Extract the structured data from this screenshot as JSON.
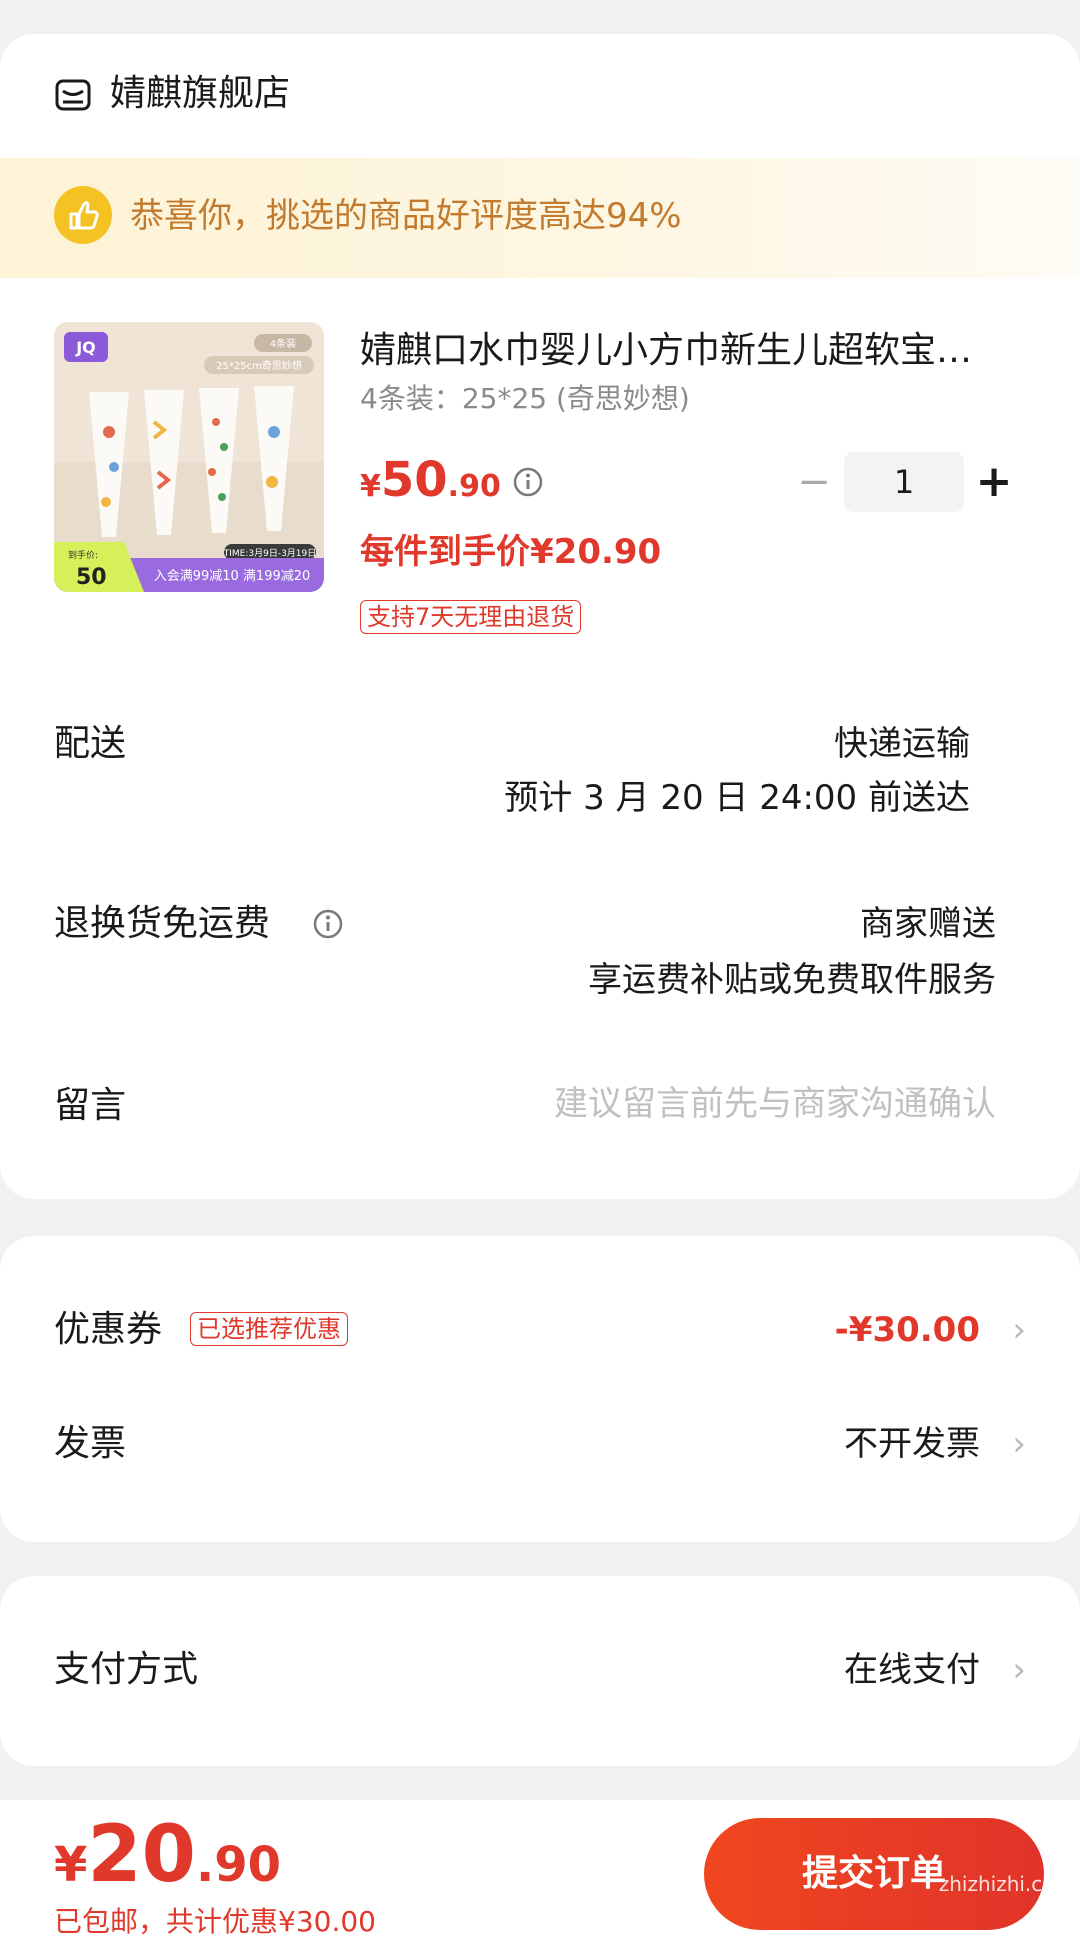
{
  "store": {
    "name": "婧麒旗舰店",
    "icon": "store-icon"
  },
  "banner": {
    "text": "恭喜你，挑选的商品好评度高达94%",
    "icon": "thumbs-up-icon"
  },
  "product": {
    "image_badge": "JQ",
    "image_pack": "4条装",
    "image_size": "25*25cm奇思妙想",
    "image_time": "TIME:3月9日-3月19日",
    "image_promo": "入会满99减10 满199减20",
    "image_price_label": "到手价:",
    "image_price": "50",
    "title": "婧麒口水巾婴儿小方巾新生儿超软宝…",
    "spec": "4条装：25*25 (奇思妙想)",
    "price_currency": "¥",
    "price_int": "50",
    "price_dec": ".90",
    "quantity": "1",
    "unit_price": "每件到手价¥20.90",
    "return_policy": "支持7天无理由退货"
  },
  "delivery": {
    "label": "配送",
    "method": "快递运输",
    "eta": "预计 3 月 20 日 24:00 前送达"
  },
  "return_shipping": {
    "label": "退换货免运费",
    "value": "商家赠送",
    "desc": "享运费补贴或免费取件服务"
  },
  "message": {
    "label": "留言",
    "placeholder": "建议留言前先与商家沟通确认"
  },
  "coupon": {
    "label": "优惠券",
    "tag": "已选推荐优惠",
    "value": "-¥30.00"
  },
  "invoice": {
    "label": "发票",
    "value": "不开发票"
  },
  "payment": {
    "label": "支付方式",
    "value": "在线支付"
  },
  "footer": {
    "total_currency": "¥",
    "total_int": "20",
    "total_dec": ".90",
    "note": "已包邮，共计优惠¥30.00",
    "submit": "提交订单",
    "watermark": "zhizhizhi.com"
  },
  "colors": {
    "accent_red": "#e0392b",
    "banner_text": "#c27b2e",
    "banner_bg": "#fdf3d6"
  }
}
